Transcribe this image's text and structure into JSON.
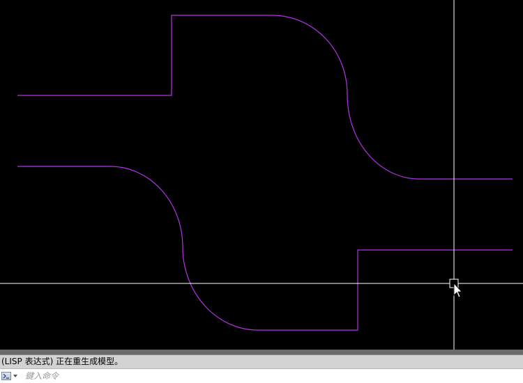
{
  "canvas": {
    "background": "#000000",
    "geometry_color": "#b233e6",
    "crosshair_color": "#ffffff"
  },
  "command_line": {
    "history_text": "(LISP 表达式) 正在重生成模型。",
    "input_value": "",
    "input_placeholder": "鍵入命令",
    "icon": "command-prompt-icon"
  }
}
